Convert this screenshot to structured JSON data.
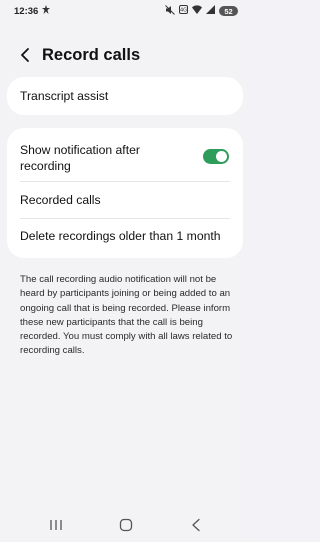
{
  "status_bar": {
    "time": "12:36",
    "battery_level": "52",
    "icons": [
      "notification-icon",
      "mute-icon",
      "volte-icon",
      "wifi-icon",
      "signal-icon",
      "battery-icon"
    ]
  },
  "header": {
    "title": "Record calls"
  },
  "settings": {
    "transcript_assist": "Transcript assist",
    "show_notification": {
      "label": "Show notification after recording",
      "enabled": true
    },
    "recorded_calls": "Recorded calls",
    "delete_recordings": "Delete recordings older than 1 month"
  },
  "info_text": "The call recording audio notification will not be heard by participants joining or being added to an ongoing call that is being recorded. Please inform these new participants that the call is being recorded. You must comply with all laws related to recording calls.",
  "colors": {
    "toggle_on": "#2e9c5a",
    "background": "#f3f3f6",
    "card": "#ffffff"
  }
}
